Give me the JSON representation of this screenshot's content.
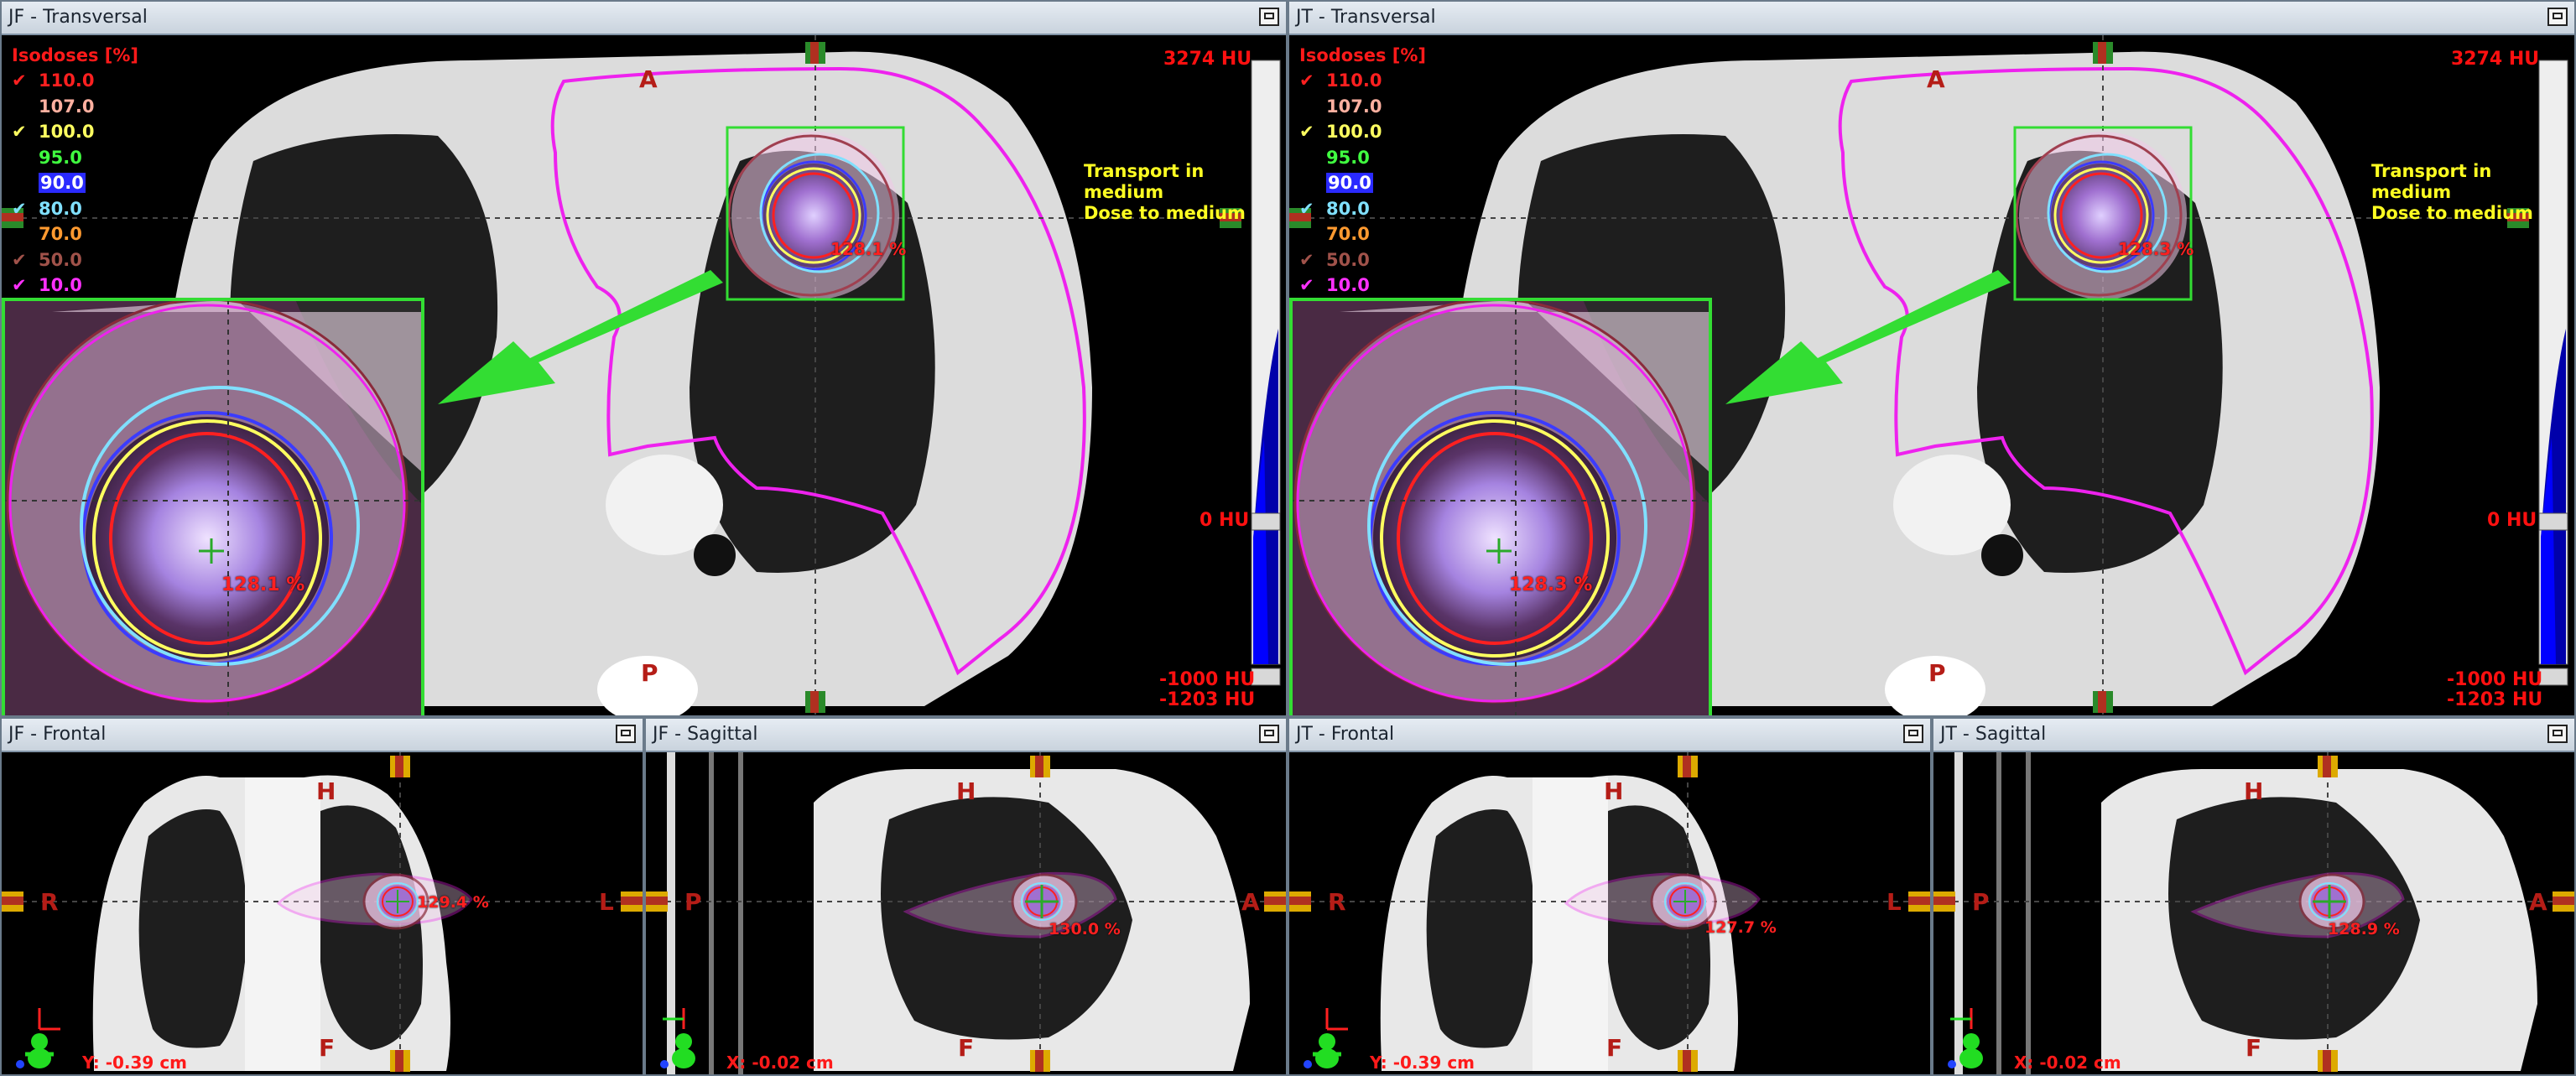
{
  "colors": {
    "accent_green": "#33dd33",
    "contour_magenta": "#ee22ee",
    "iso_red": "#ff1a1a",
    "text_yellow": "#ffff22"
  },
  "panels": {
    "jf_transversal": {
      "title": "JF  - Transversal",
      "top": "A",
      "bottom": "P",
      "hu_max": "3274 HU",
      "hu_zero": "0 HU",
      "hu_min1": "-1000 HU",
      "hu_min2": "-1203 HU",
      "max_dose_small": "128.1 %",
      "max_dose_zoom": "128.1 %"
    },
    "jt_transversal": {
      "title": "JT  - Transversal",
      "top": "A",
      "bottom": "P",
      "hu_max": "3274 HU",
      "hu_zero": "0 HU",
      "hu_min1": "-1000 HU",
      "hu_min2": "-1203 HU",
      "max_dose_small": "128.3 %",
      "max_dose_zoom": "128.3 %"
    },
    "jf_frontal": {
      "title": "JF  - Frontal",
      "top": "H",
      "bottom": "F",
      "left": "R",
      "right": "L",
      "coord": "Y: -0.39 cm",
      "max_dose": "129.4 %"
    },
    "jf_sagittal": {
      "title": "JF  - Sagittal",
      "top": "H",
      "bottom": "F",
      "left": "P",
      "right": "A",
      "coord": "X: -0.02 cm",
      "max_dose": "130.0 %"
    },
    "jt_frontal": {
      "title": "JT  - Frontal",
      "top": "H",
      "bottom": "F",
      "left": "R",
      "right": "L",
      "coord": "Y: -0.39 cm",
      "max_dose": "127.7 %"
    },
    "jt_sagittal": {
      "title": "JT  - Sagittal",
      "top": "H",
      "bottom": "F",
      "left": "P",
      "right": "A",
      "coord": "X: -0.02 cm",
      "max_dose": "128.9 %"
    }
  },
  "isodoses": {
    "title": "Isodoses [%]",
    "levels": [
      {
        "value": "110.0",
        "color": "#ff2020",
        "checked": true
      },
      {
        "value": "107.0",
        "color": "#ffb0a0",
        "checked": false
      },
      {
        "value": "100.0",
        "color": "#ffff60",
        "checked": true
      },
      {
        "value": "95.0",
        "color": "#40ff40",
        "checked": false
      },
      {
        "value": "90.0",
        "color": "#3b3bff",
        "checked": false
      },
      {
        "value": "80.0",
        "color": "#80e0ff",
        "checked": true
      },
      {
        "value": "70.0",
        "color": "#ff9a30",
        "checked": false
      },
      {
        "value": "50.0",
        "color": "#a0524a",
        "checked": true
      },
      {
        "value": "10.0",
        "color": "#ff30ff",
        "checked": true
      }
    ]
  },
  "transport": {
    "line1": "Transport in",
    "line2": "medium",
    "line3": "Dose to medium"
  }
}
